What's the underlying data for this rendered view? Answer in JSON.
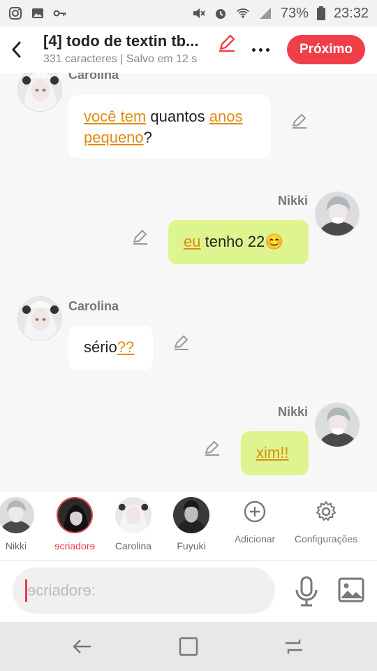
{
  "status_bar": {
    "battery": "73%",
    "time": "23:32"
  },
  "header": {
    "title": "[4] todo de textin tb...",
    "subtitle": "331 caracteres | Salvo em 12 s",
    "next_label": "Próximo"
  },
  "messages": [
    {
      "side": "left",
      "name": "Carolina",
      "segments": [
        {
          "text": "você tem",
          "kw": true
        },
        {
          "text": " quantos ",
          "kw": false
        },
        {
          "text": "anos pequeno",
          "kw": true
        },
        {
          "text": "?",
          "kw": false
        }
      ]
    },
    {
      "side": "right",
      "name": "Nikki",
      "segments": [
        {
          "text": "eu",
          "kw": true
        },
        {
          "text": " tenho 22😊",
          "kw": false
        }
      ]
    },
    {
      "side": "left",
      "name": "Carolina",
      "segments": [
        {
          "text": "sério",
          "kw": false
        },
        {
          "text": "??",
          "kw": true
        }
      ]
    },
    {
      "side": "right",
      "name": "Nikki",
      "segments": [
        {
          "text": "xim!!",
          "kw": true
        }
      ]
    }
  ],
  "characters": [
    {
      "label": "Nikki",
      "active": false
    },
    {
      "label": "ɘcriadorɘ",
      "active": true
    },
    {
      "label": "Carolina",
      "active": false
    },
    {
      "label": "Fuyuki",
      "active": false
    }
  ],
  "actions": {
    "add_label": "Adicionar",
    "settings_label": "Configurações"
  },
  "composer": {
    "placeholder": "ɘcriadorɘ:"
  },
  "colors": {
    "accent": "#ef3f49",
    "keyword": "#e08a10",
    "bubble_right": "#def58f",
    "bubble_left": "#ffffff"
  }
}
